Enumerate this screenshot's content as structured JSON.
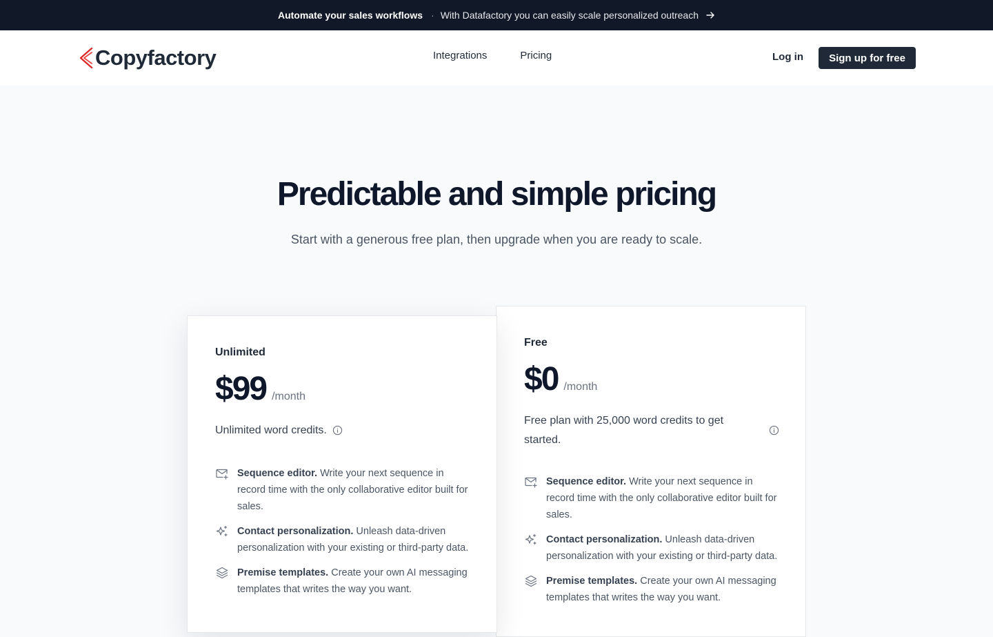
{
  "announcement": {
    "title": "Automate your sales workflows",
    "separator": "·",
    "message": "With Datafactory you can easily scale personalized outreach"
  },
  "nav": {
    "logo_text": "Copyfactory",
    "links": [
      "Integrations",
      "Pricing"
    ],
    "login": "Log in",
    "signup": "Sign up for free"
  },
  "hero": {
    "title": "Predictable and simple pricing",
    "subtitle": "Start with a generous free plan, then upgrade when you are ready to scale."
  },
  "plans": [
    {
      "name": "Unlimited",
      "price": "$99",
      "per": "/month",
      "description": "Unlimited word credits.",
      "features": [
        {
          "icon": "mail-plus-icon",
          "title": "Sequence editor.",
          "text": "Write your next sequence in record time with the only collaborative editor built for sales."
        },
        {
          "icon": "sparkles-icon",
          "title": "Contact personalization.",
          "text": "Unleash data-driven personalization with your existing or third-party data."
        },
        {
          "icon": "layers-icon",
          "title": "Premise templates.",
          "text": "Create your own AI messaging templates that writes the way you want."
        }
      ]
    },
    {
      "name": "Free",
      "price": "$0",
      "per": "/month",
      "description": "Free plan with 25,000 word credits to get started.",
      "features": [
        {
          "icon": "mail-plus-icon",
          "title": "Sequence editor.",
          "text": "Write your next sequence in record time with the only collaborative editor built for sales."
        },
        {
          "icon": "sparkles-icon",
          "title": "Contact personalization.",
          "text": "Unleash data-driven personalization with your existing or third-party data."
        },
        {
          "icon": "layers-icon",
          "title": "Premise templates.",
          "text": "Create your own AI messaging templates that writes the way you want."
        }
      ]
    }
  ],
  "colors": {
    "announcement_bg": "#111827",
    "primary_button": "#1f2937",
    "logo_accent": "#dc2626",
    "page_bg": "#f8fafc"
  }
}
